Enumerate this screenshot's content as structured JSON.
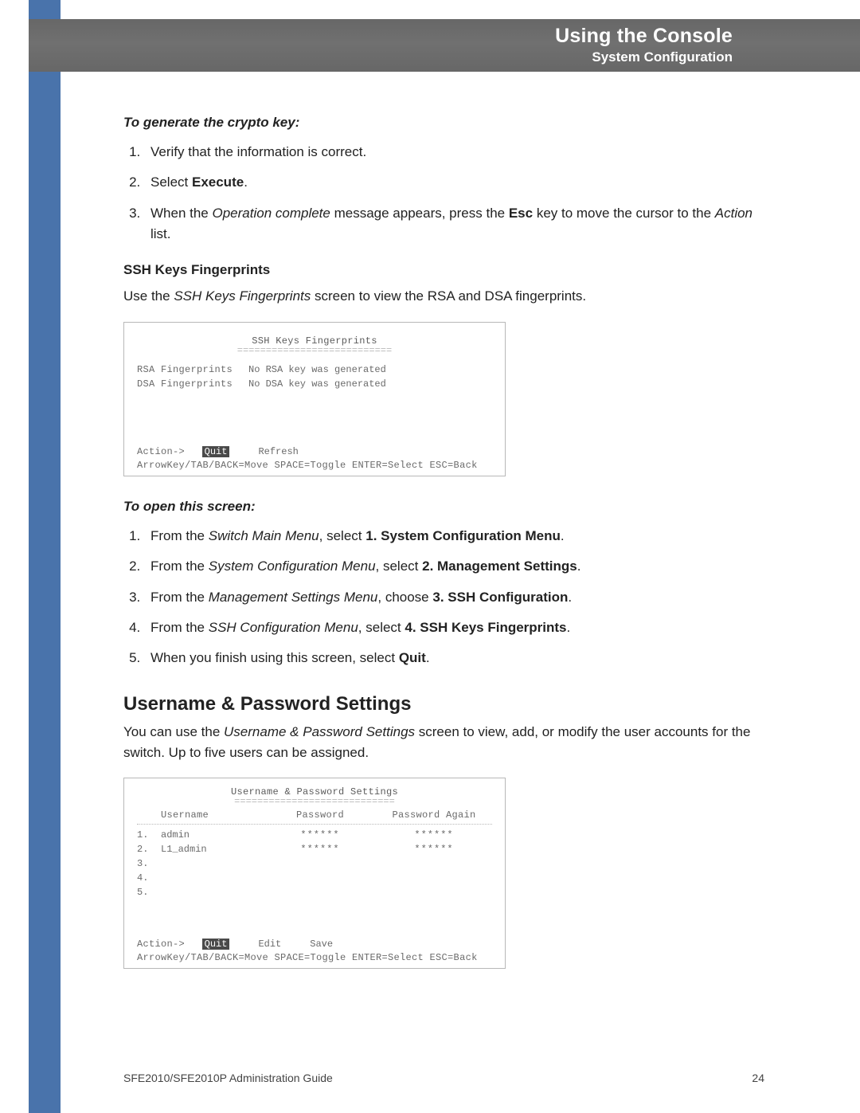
{
  "header": {
    "title": "Using the Console",
    "subtitle": "System Configuration"
  },
  "genkey": {
    "heading": "To generate the crypto key:",
    "step1": "Verify that the information is correct.",
    "step2_pre": "Select ",
    "step2_bold": "Execute",
    "step2_post": ".",
    "step3_a": "When the ",
    "step3_b": "Operation complete",
    "step3_c": " message appears, press the ",
    "step3_d": "Esc",
    "step3_e": " key to move the cursor to the ",
    "step3_f": "Action",
    "step3_g": " list."
  },
  "ssh": {
    "heading": "SSH Keys Fingerprints",
    "intro_a": "Use the ",
    "intro_b": "SSH Keys Fingerprints",
    "intro_c": " screen to view the RSA and DSA fingerprints."
  },
  "console1": {
    "title": "SSH Keys Fingerprints",
    "under": "===========================",
    "row1_label": "RSA Fingerprints",
    "row1_val": "No RSA key was generated",
    "row2_label": "DSA Fingerprints",
    "row2_val": "No DSA key was generated",
    "action_label": "Action->",
    "action_quit": "Quit",
    "action_refresh": "Refresh",
    "hint": "ArrowKey/TAB/BACK=Move  SPACE=Toggle  ENTER=Select  ESC=Back"
  },
  "open": {
    "heading": "To open this screen:",
    "s1_a": "From the ",
    "s1_b": "Switch Main Menu",
    "s1_c": ", select ",
    "s1_d": "1. System Configuration Menu",
    "s1_e": ".",
    "s2_a": "From the ",
    "s2_b": "System Configuration Menu",
    "s2_c": ", select ",
    "s2_d": "2. Management Settings",
    "s2_e": ".",
    "s3_a": "From the ",
    "s3_b": "Management Settings Menu",
    "s3_c": ", choose ",
    "s3_d": "3. SSH Configuration",
    "s3_e": ".",
    "s4_a": "From the ",
    "s4_b": "SSH Configuration Menu",
    "s4_c": ", select ",
    "s4_d": "4. SSH Keys Fingerprints",
    "s4_e": ".",
    "s5_a": "When you finish using this screen, select ",
    "s5_b": "Quit",
    "s5_c": "."
  },
  "userpw": {
    "heading": "Username & Password Settings",
    "intro_a": "You can use the ",
    "intro_b": "Username & Password Settings",
    "intro_c": " screen to view, add, or modify the user accounts for the switch. Up to five users can be assigned."
  },
  "console2": {
    "title": "Username & Password Settings",
    "under": "============================",
    "col1": "Username",
    "col2": "Password",
    "col3": "Password Again",
    "r1_n": "1.",
    "r1_u": "admin",
    "r1_p": "******",
    "r1_p2": "******",
    "r2_n": "2.",
    "r2_u": "L1_admin",
    "r2_p": "******",
    "r2_p2": "******",
    "r3_n": "3.",
    "r4_n": "4.",
    "r5_n": "5.",
    "action_label": "Action->",
    "action_quit": "Quit",
    "action_edit": "Edit",
    "action_save": "Save",
    "hint": "ArrowKey/TAB/BACK=Move  SPACE=Toggle  ENTER=Select  ESC=Back"
  },
  "footer": {
    "doc": "SFE2010/SFE2010P Administration Guide",
    "page": "24"
  }
}
